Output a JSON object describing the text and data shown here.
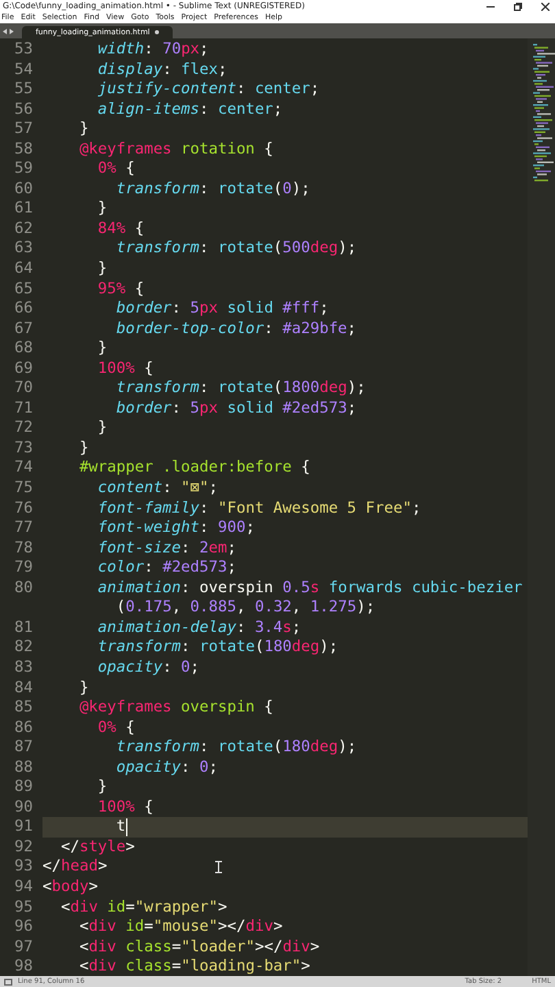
{
  "window": {
    "title": "G:\\Code\\funny_loading_animation.html • - Sublime Text (UNREGISTERED)"
  },
  "menu": [
    "File",
    "Edit",
    "Selection",
    "Find",
    "View",
    "Goto",
    "Tools",
    "Project",
    "Preferences",
    "Help"
  ],
  "tabs": [
    {
      "label": "funny_loading_animation.html",
      "selected": true,
      "modified": true
    }
  ],
  "editor": {
    "lines": [
      {
        "n": "53",
        "current": false,
        "tokens": [
          {
            "kind": "prop",
            "text": "      width"
          },
          {
            "kind": "p",
            "text": ": "
          },
          {
            "kind": "num",
            "text": "70"
          },
          {
            "kind": "unit",
            "text": "px"
          },
          {
            "kind": "p",
            "text": ";"
          }
        ]
      },
      {
        "n": "54",
        "current": false,
        "tokens": [
          {
            "kind": "prop",
            "text": "      display"
          },
          {
            "kind": "p",
            "text": ": "
          },
          {
            "kind": "val",
            "text": "flex"
          },
          {
            "kind": "p",
            "text": ";"
          }
        ]
      },
      {
        "n": "55",
        "current": false,
        "tokens": [
          {
            "kind": "prop",
            "text": "      justify-content"
          },
          {
            "kind": "p",
            "text": ": "
          },
          {
            "kind": "val",
            "text": "center"
          },
          {
            "kind": "p",
            "text": ";"
          }
        ]
      },
      {
        "n": "56",
        "current": false,
        "tokens": [
          {
            "kind": "prop",
            "text": "      align-items"
          },
          {
            "kind": "p",
            "text": ": "
          },
          {
            "kind": "val",
            "text": "center"
          },
          {
            "kind": "p",
            "text": ";"
          }
        ]
      },
      {
        "n": "57",
        "current": false,
        "tokens": [
          {
            "kind": "p",
            "text": "    }"
          }
        ]
      },
      {
        "n": "58",
        "current": false,
        "tokens": [
          {
            "kind": "at",
            "text": "    @keyframes"
          },
          {
            "kind": "sel",
            "text": " rotation"
          },
          {
            "kind": "p",
            "text": " {"
          }
        ]
      },
      {
        "n": "59",
        "current": false,
        "tokens": [
          {
            "kind": "at",
            "text": "      0%"
          },
          {
            "kind": "p",
            "text": " {"
          }
        ]
      },
      {
        "n": "60",
        "current": false,
        "tokens": [
          {
            "kind": "prop",
            "text": "        transform"
          },
          {
            "kind": "p",
            "text": ": "
          },
          {
            "kind": "val",
            "text": "rotate"
          },
          {
            "kind": "p",
            "text": "("
          },
          {
            "kind": "num",
            "text": "0"
          },
          {
            "kind": "p",
            "text": ");"
          }
        ]
      },
      {
        "n": "61",
        "current": false,
        "tokens": [
          {
            "kind": "p",
            "text": "      }"
          }
        ]
      },
      {
        "n": "62",
        "current": false,
        "tokens": [
          {
            "kind": "at",
            "text": "      84%"
          },
          {
            "kind": "p",
            "text": " {"
          }
        ]
      },
      {
        "n": "63",
        "current": false,
        "tokens": [
          {
            "kind": "prop",
            "text": "        transform"
          },
          {
            "kind": "p",
            "text": ": "
          },
          {
            "kind": "val",
            "text": "rotate"
          },
          {
            "kind": "p",
            "text": "("
          },
          {
            "kind": "num",
            "text": "500"
          },
          {
            "kind": "unit",
            "text": "deg"
          },
          {
            "kind": "p",
            "text": ");"
          }
        ]
      },
      {
        "n": "64",
        "current": false,
        "tokens": [
          {
            "kind": "p",
            "text": "      }"
          }
        ]
      },
      {
        "n": "65",
        "current": false,
        "tokens": [
          {
            "kind": "at",
            "text": "      95%"
          },
          {
            "kind": "p",
            "text": " {"
          }
        ]
      },
      {
        "n": "66",
        "current": false,
        "tokens": [
          {
            "kind": "prop",
            "text": "        border"
          },
          {
            "kind": "p",
            "text": ": "
          },
          {
            "kind": "num",
            "text": "5"
          },
          {
            "kind": "unit",
            "text": "px"
          },
          {
            "kind": "val",
            "text": " solid"
          },
          {
            "kind": "num",
            "text": " #fff"
          },
          {
            "kind": "p",
            "text": ";"
          }
        ]
      },
      {
        "n": "67",
        "current": false,
        "tokens": [
          {
            "kind": "prop",
            "text": "        border-top-color"
          },
          {
            "kind": "p",
            "text": ": "
          },
          {
            "kind": "num",
            "text": "#a29bfe"
          },
          {
            "kind": "p",
            "text": ";"
          }
        ]
      },
      {
        "n": "68",
        "current": false,
        "tokens": [
          {
            "kind": "p",
            "text": "      }"
          }
        ]
      },
      {
        "n": "69",
        "current": false,
        "tokens": [
          {
            "kind": "at",
            "text": "      100%"
          },
          {
            "kind": "p",
            "text": " {"
          }
        ]
      },
      {
        "n": "70",
        "current": false,
        "tokens": [
          {
            "kind": "prop",
            "text": "        transform"
          },
          {
            "kind": "p",
            "text": ": "
          },
          {
            "kind": "val",
            "text": "rotate"
          },
          {
            "kind": "p",
            "text": "("
          },
          {
            "kind": "num",
            "text": "1800"
          },
          {
            "kind": "unit",
            "text": "deg"
          },
          {
            "kind": "p",
            "text": ");"
          }
        ]
      },
      {
        "n": "71",
        "current": false,
        "tokens": [
          {
            "kind": "prop",
            "text": "        border"
          },
          {
            "kind": "p",
            "text": ": "
          },
          {
            "kind": "num",
            "text": "5"
          },
          {
            "kind": "unit",
            "text": "px"
          },
          {
            "kind": "val",
            "text": " solid"
          },
          {
            "kind": "num",
            "text": " #2ed573"
          },
          {
            "kind": "p",
            "text": ";"
          }
        ]
      },
      {
        "n": "72",
        "current": false,
        "tokens": [
          {
            "kind": "p",
            "text": "      }"
          }
        ]
      },
      {
        "n": "73",
        "current": false,
        "tokens": [
          {
            "kind": "p",
            "text": "    }"
          }
        ]
      },
      {
        "n": "74",
        "current": false,
        "tokens": [
          {
            "kind": "sel",
            "text": "    #wrapper .loader:before"
          },
          {
            "kind": "p",
            "text": " {"
          }
        ]
      },
      {
        "n": "75",
        "current": false,
        "tokens": [
          {
            "kind": "prop",
            "text": "      content"
          },
          {
            "kind": "p",
            "text": ": "
          },
          {
            "kind": "str",
            "text": "\"⊠\""
          },
          {
            "kind": "p",
            "text": ";"
          }
        ]
      },
      {
        "n": "76",
        "current": false,
        "tokens": [
          {
            "kind": "prop",
            "text": "      font-family"
          },
          {
            "kind": "p",
            "text": ": "
          },
          {
            "kind": "str",
            "text": "\"Font Awesome 5 Free\""
          },
          {
            "kind": "p",
            "text": ";"
          }
        ]
      },
      {
        "n": "77",
        "current": false,
        "tokens": [
          {
            "kind": "prop",
            "text": "      font-weight"
          },
          {
            "kind": "p",
            "text": ": "
          },
          {
            "kind": "num",
            "text": "900"
          },
          {
            "kind": "p",
            "text": ";"
          }
        ]
      },
      {
        "n": "78",
        "current": false,
        "tokens": [
          {
            "kind": "prop",
            "text": "      font-size"
          },
          {
            "kind": "p",
            "text": ": "
          },
          {
            "kind": "num",
            "text": "2"
          },
          {
            "kind": "unit",
            "text": "em"
          },
          {
            "kind": "p",
            "text": ";"
          }
        ]
      },
      {
        "n": "79",
        "current": false,
        "tokens": [
          {
            "kind": "prop",
            "text": "      color"
          },
          {
            "kind": "p",
            "text": ": "
          },
          {
            "kind": "num",
            "text": "#2ed573"
          },
          {
            "kind": "p",
            "text": ";"
          }
        ]
      },
      {
        "n": "80",
        "current": false,
        "tokens": [
          {
            "kind": "prop",
            "text": "      animation"
          },
          {
            "kind": "p",
            "text": ": overspin "
          },
          {
            "kind": "num",
            "text": "0.5"
          },
          {
            "kind": "unit",
            "text": "s"
          },
          {
            "kind": "val",
            "text": " forwards cubic-bezier"
          },
          {
            "kind": "break",
            "text": "        ("
          },
          {
            "kind": "num",
            "text": "0.175"
          },
          {
            "kind": "p",
            "text": ", "
          },
          {
            "kind": "num",
            "text": "0.885"
          },
          {
            "kind": "p",
            "text": ", "
          },
          {
            "kind": "num",
            "text": "0.32"
          },
          {
            "kind": "p",
            "text": ", "
          },
          {
            "kind": "num",
            "text": "1.275"
          },
          {
            "kind": "p",
            "text": ");"
          }
        ]
      },
      {
        "n": "81",
        "current": false,
        "tokens": [
          {
            "kind": "prop",
            "text": "      animation-delay"
          },
          {
            "kind": "p",
            "text": ": "
          },
          {
            "kind": "num",
            "text": "3.4"
          },
          {
            "kind": "unit",
            "text": "s"
          },
          {
            "kind": "p",
            "text": ";"
          }
        ]
      },
      {
        "n": "82",
        "current": false,
        "tokens": [
          {
            "kind": "prop",
            "text": "      transform"
          },
          {
            "kind": "p",
            "text": ": "
          },
          {
            "kind": "val",
            "text": "rotate"
          },
          {
            "kind": "p",
            "text": "("
          },
          {
            "kind": "num",
            "text": "180"
          },
          {
            "kind": "unit",
            "text": "deg"
          },
          {
            "kind": "p",
            "text": ");"
          }
        ]
      },
      {
        "n": "83",
        "current": false,
        "tokens": [
          {
            "kind": "prop",
            "text": "      opacity"
          },
          {
            "kind": "p",
            "text": ": "
          },
          {
            "kind": "num",
            "text": "0"
          },
          {
            "kind": "p",
            "text": ";"
          }
        ]
      },
      {
        "n": "84",
        "current": false,
        "tokens": [
          {
            "kind": "p",
            "text": "    }"
          }
        ]
      },
      {
        "n": "85",
        "current": false,
        "tokens": [
          {
            "kind": "at",
            "text": "    @keyframes"
          },
          {
            "kind": "sel",
            "text": " overspin"
          },
          {
            "kind": "p",
            "text": " {"
          }
        ]
      },
      {
        "n": "86",
        "current": false,
        "tokens": [
          {
            "kind": "at",
            "text": "      0%"
          },
          {
            "kind": "p",
            "text": " {"
          }
        ]
      },
      {
        "n": "87",
        "current": false,
        "tokens": [
          {
            "kind": "prop",
            "text": "        transform"
          },
          {
            "kind": "p",
            "text": ": "
          },
          {
            "kind": "val",
            "text": "rotate"
          },
          {
            "kind": "p",
            "text": "("
          },
          {
            "kind": "num",
            "text": "180"
          },
          {
            "kind": "unit",
            "text": "deg"
          },
          {
            "kind": "p",
            "text": ");"
          }
        ]
      },
      {
        "n": "88",
        "current": false,
        "tokens": [
          {
            "kind": "prop",
            "text": "        opacity"
          },
          {
            "kind": "p",
            "text": ": "
          },
          {
            "kind": "num",
            "text": "0"
          },
          {
            "kind": "p",
            "text": ";"
          }
        ]
      },
      {
        "n": "89",
        "current": false,
        "tokens": [
          {
            "kind": "p",
            "text": "      }"
          }
        ]
      },
      {
        "n": "90",
        "current": false,
        "tokens": [
          {
            "kind": "at",
            "text": "      100%"
          },
          {
            "kind": "p",
            "text": " {"
          }
        ]
      },
      {
        "n": "91",
        "current": true,
        "tokens": [
          {
            "kind": "p",
            "text": "        t"
          }
        ]
      },
      {
        "n": "92",
        "current": false,
        "tokens": [
          {
            "kind": "p",
            "text": "  </"
          },
          {
            "kind": "tag",
            "text": "style"
          },
          {
            "kind": "p",
            "text": ">"
          }
        ]
      },
      {
        "n": "93",
        "current": false,
        "tokens": [
          {
            "kind": "p",
            "text": "</"
          },
          {
            "kind": "tag",
            "text": "head"
          },
          {
            "kind": "p",
            "text": ">"
          }
        ]
      },
      {
        "n": "94",
        "current": false,
        "tokens": [
          {
            "kind": "p",
            "text": "<"
          },
          {
            "kind": "tag",
            "text": "body"
          },
          {
            "kind": "p",
            "text": ">"
          }
        ]
      },
      {
        "n": "95",
        "current": false,
        "tokens": [
          {
            "kind": "p",
            "text": "  <"
          },
          {
            "kind": "tag",
            "text": "div"
          },
          {
            "kind": "attr",
            "text": " id"
          },
          {
            "kind": "p",
            "text": "="
          },
          {
            "kind": "str",
            "text": "\"wrapper\""
          },
          {
            "kind": "p",
            "text": ">"
          }
        ]
      },
      {
        "n": "96",
        "current": false,
        "tokens": [
          {
            "kind": "p",
            "text": "    <"
          },
          {
            "kind": "tag",
            "text": "div"
          },
          {
            "kind": "attr",
            "text": " id"
          },
          {
            "kind": "p",
            "text": "="
          },
          {
            "kind": "str",
            "text": "\"mouse\""
          },
          {
            "kind": "p",
            "text": "></"
          },
          {
            "kind": "tag",
            "text": "div"
          },
          {
            "kind": "p",
            "text": ">"
          }
        ]
      },
      {
        "n": "97",
        "current": false,
        "tokens": [
          {
            "kind": "p",
            "text": "    <"
          },
          {
            "kind": "tag",
            "text": "div"
          },
          {
            "kind": "attr",
            "text": " class"
          },
          {
            "kind": "p",
            "text": "="
          },
          {
            "kind": "str",
            "text": "\"loader\""
          },
          {
            "kind": "p",
            "text": "></"
          },
          {
            "kind": "tag",
            "text": "div"
          },
          {
            "kind": "p",
            "text": ">"
          }
        ]
      },
      {
        "n": "98",
        "current": false,
        "tokens": [
          {
            "kind": "p",
            "text": "    <"
          },
          {
            "kind": "tag",
            "text": "div"
          },
          {
            "kind": "attr",
            "text": " class"
          },
          {
            "kind": "p",
            "text": "="
          },
          {
            "kind": "str",
            "text": "\"loading-bar\""
          },
          {
            "kind": "p",
            "text": ">"
          }
        ]
      }
    ]
  },
  "status_bar": {
    "position": "Line 91, Column 16",
    "tab_size": "Tab Size: 2",
    "syntax": "HTML"
  }
}
